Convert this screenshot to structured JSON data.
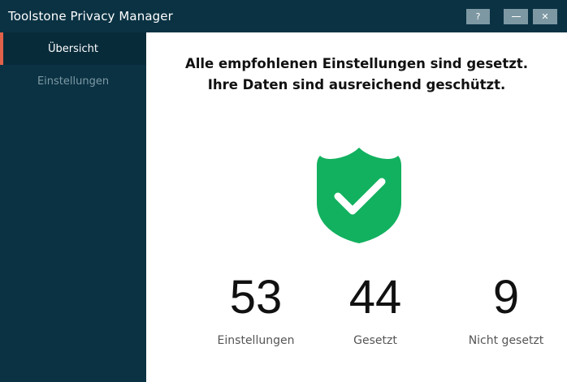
{
  "window": {
    "title": "Toolstone Privacy Manager",
    "help_label": "?",
    "close_label": "✕"
  },
  "sidebar": {
    "items": [
      {
        "label": "Übersicht",
        "active": true
      },
      {
        "label": "Einstellungen",
        "active": false
      }
    ]
  },
  "main": {
    "headline_line1": "Alle empfohlenen Einstellungen sind gesetzt.",
    "headline_line2": "Ihre Daten sind ausreichend geschützt.",
    "status_icon": "shield-check-icon",
    "stats": [
      {
        "value": "53",
        "label": "Einstellungen"
      },
      {
        "value": "44",
        "label": "Gesetzt"
      },
      {
        "value": "9",
        "label": "Nicht gesetzt"
      }
    ]
  },
  "colors": {
    "sidebar_bg": "#0a3243",
    "active_accent": "#e0614a",
    "shield_green": "#12b15f",
    "window_button": "#7e98a3"
  }
}
